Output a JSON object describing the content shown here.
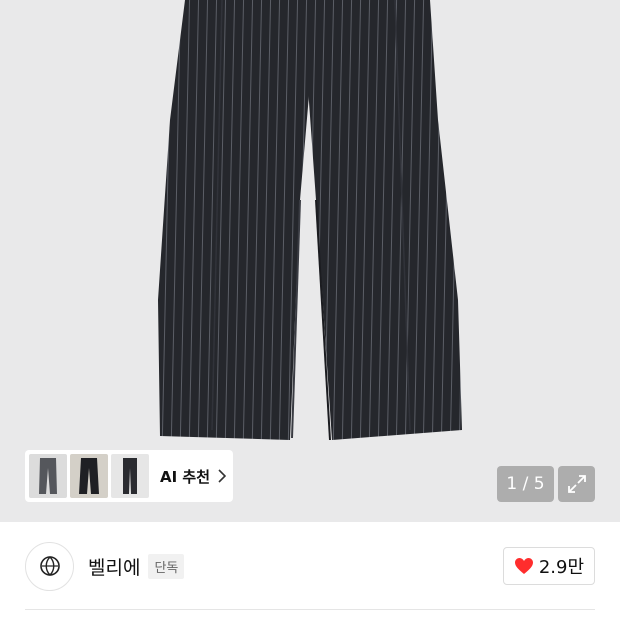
{
  "gallery": {
    "counter": "1 / 5",
    "similar": {
      "label": "AI 추천",
      "thumbnails": [
        "charcoal-trousers",
        "black-trousers",
        "black-slim-trousers"
      ]
    },
    "expand_icon": "expand-arrows-icon"
  },
  "brand": {
    "name": "벨리에",
    "badge": "단독",
    "logo_icon": "brand-emblem-icon"
  },
  "like": {
    "count": "2.9만",
    "icon": "heart-icon",
    "color": "#ff2d2d"
  },
  "colors": {
    "hero_bg": "#e9e9ea",
    "garment": "#25272c",
    "stripe": "#5b5e66"
  }
}
